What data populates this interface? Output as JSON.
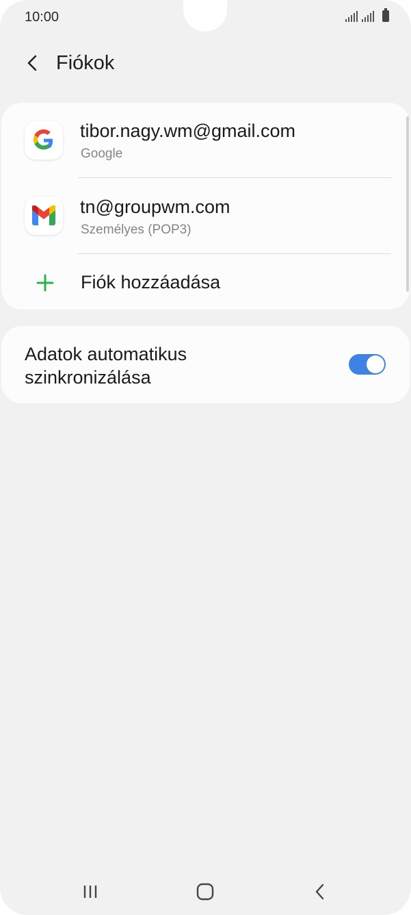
{
  "status_bar": {
    "time": "10:00",
    "icons": [
      "signal-icon",
      "signal-icon",
      "battery-icon"
    ]
  },
  "header": {
    "back_icon": "chevron-left-icon",
    "title": "Fiókok"
  },
  "accounts": [
    {
      "email": "tibor.nagy.wm@gmail.com",
      "type": "Google",
      "icon": "google-icon"
    },
    {
      "email": "tn@groupwm.com",
      "type": "Személyes (POP3)",
      "icon": "gmail-icon"
    }
  ],
  "add_account": {
    "label": "Fiók hozzáadása",
    "icon": "plus-icon"
  },
  "sync": {
    "label": "Adatok automatikus szinkronizálása",
    "enabled": true
  },
  "nav_bar": {
    "icons": [
      "recent-apps-icon",
      "home-icon",
      "back-icon"
    ]
  },
  "colors": {
    "accent": "#3e82e6",
    "plus": "#2db14a",
    "background": "#f1f1f1",
    "card": "#fcfcfc"
  }
}
